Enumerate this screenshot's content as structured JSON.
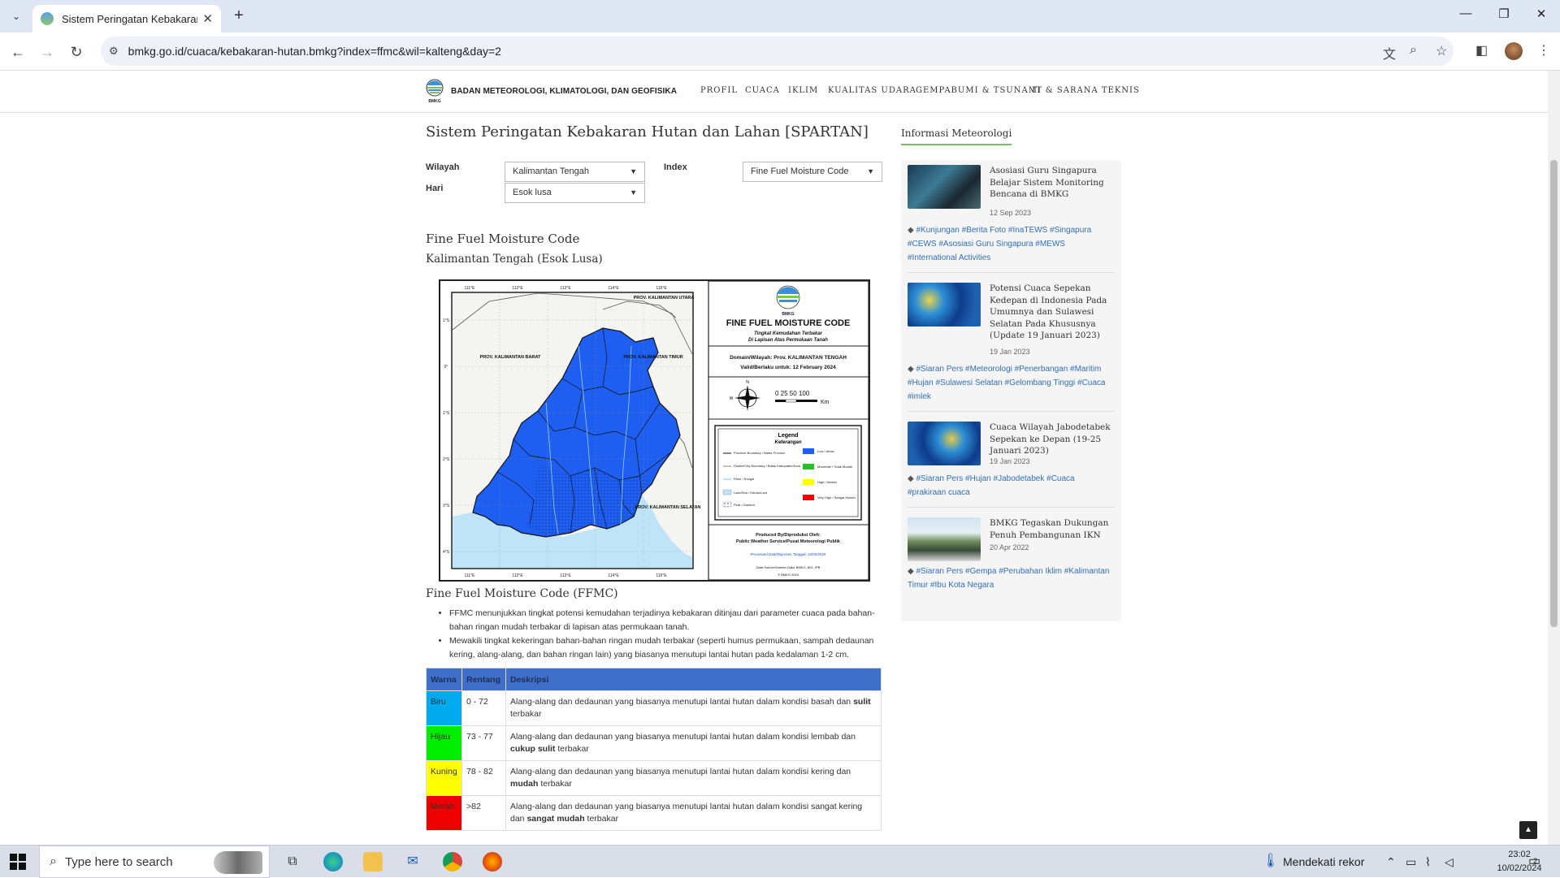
{
  "browser": {
    "tab_title": "Sistem Peringatan Kebakaran H",
    "url": "bmkg.go.id/cuaca/kebakaran-hutan.bmkg?index=ffmc&wil=kalteng&day=2"
  },
  "site": {
    "org_name": "BADAN METEOROLOGI, KLIMATOLOGI, DAN GEOFISIKA",
    "nav": [
      "PROFIL",
      "CUACA",
      "IKLIM",
      "KUALITAS UDARA",
      "GEMPABUMI & TSUNAMI",
      "IT & SARANA TEKNIS"
    ]
  },
  "page": {
    "title": "Sistem Peringatan Kebakaran Hutan dan Lahan [SPARTAN]"
  },
  "filters": {
    "wilayah_label": "Wilayah",
    "wilayah_value": "Kalimantan Tengah",
    "hari_label": "Hari",
    "hari_value": "Esok lusa",
    "index_label": "Index",
    "index_value": "Fine Fuel Moisture Code"
  },
  "section": {
    "heading": "Fine Fuel Moisture Code",
    "subheading": "Kalimantan Tengah (Esok Lusa)"
  },
  "map": {
    "lon_ticks": [
      "111°E",
      "112°E",
      "113°E",
      "114°E",
      "115°E"
    ],
    "lat_ticks": [
      "1°S",
      "0°",
      "1°S",
      "2°S",
      "3°S",
      "4°S"
    ],
    "province_labels": [
      "PROV. KALIMANTAN UTARA",
      "PROV. KALIMANTAN BARAT",
      "PROV. KALIMANTAN TIMUR",
      "PROV. KALIMANTAN SELATAN"
    ],
    "product_title": "FINE FUEL MOISTURE CODE",
    "product_sub1": "Tingkat Kemudahan Terbakar",
    "product_sub2": "Di Lapisan Atas Permukaan Tanah",
    "domain": "Domain/Wilayah: Prov. KALIMANTAN TENGAH",
    "valid": "Valid/Berlaku untuk: 12 February 2024",
    "scale_labels": "0  25 50      100",
    "scale_unit": "Km",
    "legend_title": "Legend",
    "legend_sub": "Keterangan",
    "legend_left": [
      "Province Boundary / Batas Provinsi",
      "District/City Boundary / Batas Kabupaten/Kota",
      "River / Sungai",
      "Lake/Sea / Danau/Laut",
      "Peat / Gambut"
    ],
    "legend_right": [
      {
        "label": "Low / Aman",
        "color": "#1e5ef0"
      },
      {
        "label": "Moderate / Tidak Mudah",
        "color": "#25c225"
      },
      {
        "label": "High / Mudah",
        "color": "#ffff00"
      },
      {
        "label": "Very High / Sangat Mudah",
        "color": "#ff0000"
      }
    ],
    "produced_by": "Produced By/Diproduksi Oleh:",
    "producer": "Public Weather Service/Pusat Meteorologi Publik",
    "processed": "Processed Date/Diproses Tanggal: 10/02/2024",
    "data_source": "Data Source/Sumber Data: BMKG, BIG, IPB",
    "copyright": "© BMKG 2024"
  },
  "info": {
    "heading": "Fine Fuel Moisture Code (FFMC)",
    "bullets": [
      "FFMC menunjukkan tingkat potensi kemudahan terjadinya kebakaran ditinjau dari parameter cuaca pada bahan-bahan ringan mudah terbakar di lapisan atas permukaan tanah.",
      "Mewakili tingkat kekeringan bahan-bahan ringan mudah terbakar (seperti humus permukaan, sampah dedaunan kering, alang-alang, dan bahan ringan lain) yang biasanya menutupi lantai hutan pada kedalaman 1-2 cm."
    ]
  },
  "table": {
    "headers": [
      "Warna",
      "Rentang",
      "Deskripsi"
    ],
    "rows": [
      {
        "warna": "Biru",
        "color": "#00aaee",
        "rentang": "0 - 72",
        "desc_a": "Alang-alang dan dedaunan yang biasanya menutupi lantai hutan dalam kondisi basah dan ",
        "desc_b": "sulit",
        "desc_c": " terbakar"
      },
      {
        "warna": "Hijau",
        "color": "#00ee00",
        "rentang": "73 - 77",
        "desc_a": "Alang-alang dan dedaunan yang biasanya menutupi lantai hutan dalam kondisi lembab dan ",
        "desc_b": "cukup sulit",
        "desc_c": " terbakar"
      },
      {
        "warna": "Kuning",
        "color": "#ffff00",
        "rentang": "78 - 82",
        "desc_a": "Alang-alang dan dedaunan yang biasanya menutupi lantai hutan dalam kondisi kering dan ",
        "desc_b": "mudah",
        "desc_c": " terbakar"
      },
      {
        "warna": "Merah",
        "color": "#ee0000",
        "rentang": ">82",
        "desc_a": "Alang-alang dan dedaunan yang biasanya menutupi lantai hutan dalam kondisi sangat kering dan ",
        "desc_b": "sangat mudah",
        "desc_c": " terbakar"
      }
    ]
  },
  "sidebar": {
    "heading": "Informasi Meteorologi",
    "news": [
      {
        "title": "Asosiasi Guru Singapura Belajar Sistem Monitoring Bencana di BMKG",
        "date": "12 Sep 2023",
        "tags": "#Kunjungan #Berita Foto #InaTEWS #Singapura #CEWS #Asosiasi Guru Singapura #MEWS #International Activities"
      },
      {
        "title": "Potensi Cuaca Sepekan Kedepan di Indonesia Pada Umumnya dan Sulawesi Selatan Pada Khususnya (Update 19 Januari 2023)",
        "date": "19 Jan 2023",
        "tags": "#Siaran Pers #Meteorologi #Penerbangan #Maritim #Hujan #Sulawesi Selatan #Gelombang Tinggi #Cuaca #imlek"
      },
      {
        "title": "Cuaca Wilayah Jabodetabek Sepekan ke Depan (19-25 Januari 2023)",
        "date": "19 Jan 2023",
        "tags": "#Siaran Pers #Hujan #Jabodetabek #Cuaca #prakiraan cuaca"
      },
      {
        "title": "BMKG Tegaskan Dukungan Penuh Pembangunan IKN",
        "date": "20 Apr 2022",
        "tags": "#Siaran Pers #Gempa #Perubahan Iklim #Kalimantan Timur #Ibu Kota Negara"
      }
    ]
  },
  "taskbar": {
    "search_placeholder": "Type here to search",
    "weather": "Mendekati rekor",
    "time": "23:02",
    "date": "10/02/2024",
    "notif_count": "2"
  }
}
